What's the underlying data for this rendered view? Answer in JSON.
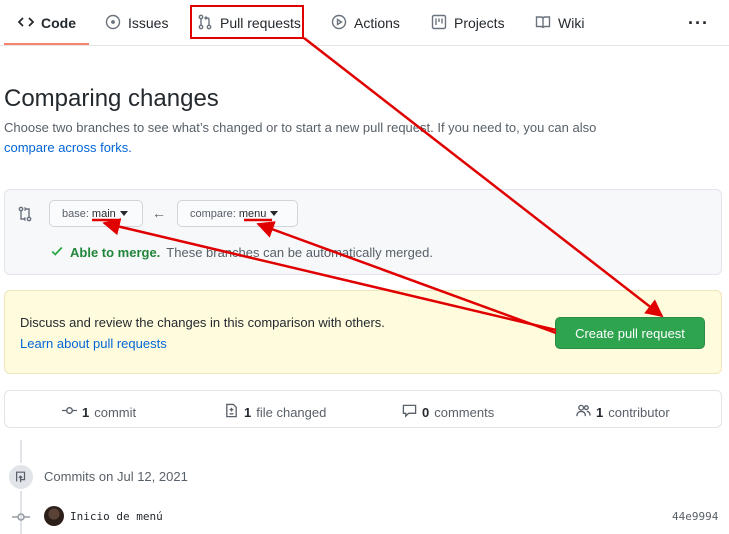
{
  "nav": {
    "tabs": [
      {
        "label": "Code",
        "icon": "code-icon",
        "selected": true
      },
      {
        "label": "Issues",
        "icon": "issue-icon"
      },
      {
        "label": "Pull requests",
        "icon": "git-pull-request-icon"
      },
      {
        "label": "Actions",
        "icon": "play-icon"
      },
      {
        "label": "Projects",
        "icon": "project-icon"
      },
      {
        "label": "Wiki",
        "icon": "book-icon"
      }
    ],
    "more_label": "···"
  },
  "header": {
    "title": "Comparing changes",
    "description": "Choose two branches to see what’s changed or to start a new pull request. If you need to, you can also ",
    "forks_link": "compare across forks."
  },
  "range": {
    "base_label": "base:",
    "base_value": "main",
    "compare_label": "compare:",
    "compare_value": "menu",
    "arrow": "←",
    "merge_status": "Able to merge.",
    "merge_detail": "These branches can be automatically merged."
  },
  "notice": {
    "text": "Discuss and review the changes in this comparison with others.",
    "link": "Learn about pull requests",
    "create_button": "Create pull request"
  },
  "summary": {
    "commits_count": "1",
    "commits_label": "commit",
    "files_count": "1",
    "files_label": "file changed",
    "comments_count": "0",
    "comments_label": "comments",
    "contributors_count": "1",
    "contributors_label": "contributor"
  },
  "timeline": {
    "commits_on": "Commits on Jul 12, 2021",
    "commit_message": "Inicio de menú",
    "commit_sha": "44e9994"
  },
  "colors": {
    "annotation": "#e00000",
    "primary_button": "#2ea44f",
    "link": "#0366d6",
    "success": "#22863a",
    "notice_bg": "#fffbdd",
    "tab_underline": "#f9826c"
  }
}
